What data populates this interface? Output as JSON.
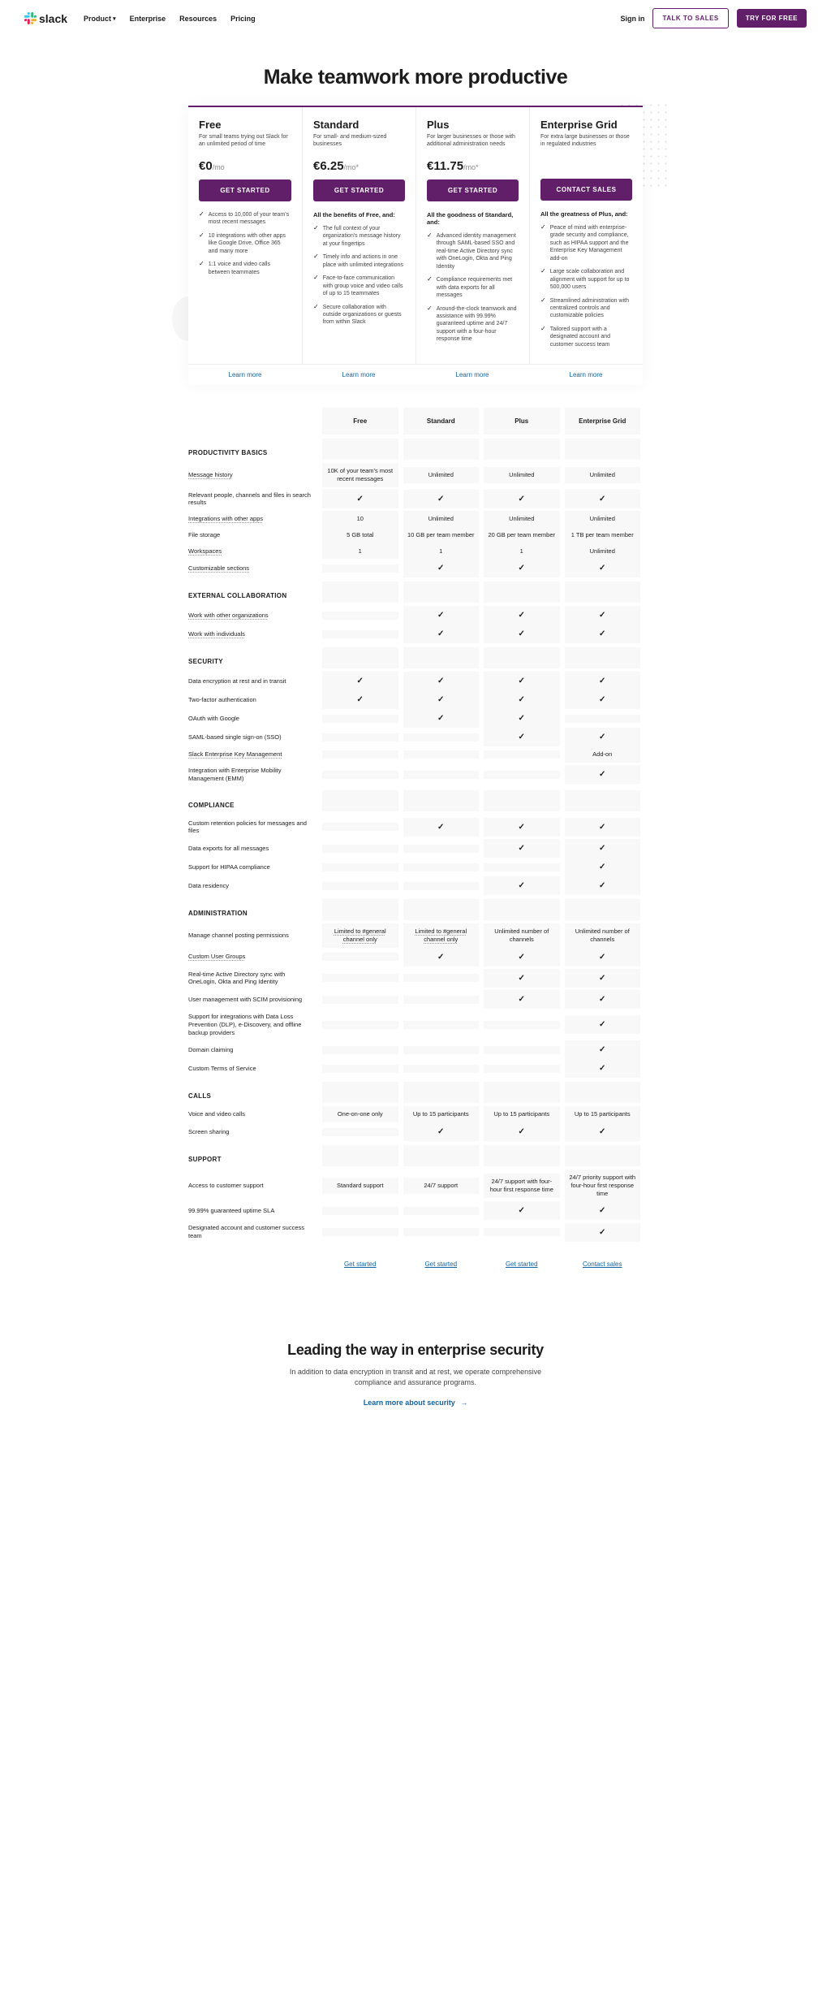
{
  "nav": {
    "brand": "slack",
    "links": [
      "Product",
      "Enterprise",
      "Resources",
      "Pricing"
    ],
    "signin": "Sign in",
    "talk": "TALK TO SALES",
    "try": "TRY FOR FREE"
  },
  "hero": {
    "title": "Make teamwork more productive"
  },
  "plans": [
    {
      "name": "Free",
      "desc": "For small teams trying out Slack for an unlimited period of time",
      "price": "€0",
      "per": "/mo",
      "cta": "GET STARTED",
      "sub": "",
      "features": [
        "Access to 10,000 of your team's most recent messages",
        "10 integrations with other apps like Google Drive, Office 365 and many more",
        "1:1 voice and video calls between teammates"
      ],
      "learn": "Learn more"
    },
    {
      "name": "Standard",
      "desc": "For small- and medium-sized businesses",
      "price": "€6.25",
      "per": "/mo*",
      "cta": "GET STARTED",
      "sub": "All the benefits of Free, and:",
      "features": [
        "The full context of your organization's message history at your fingertips",
        "Timely info and actions in one place with unlimited integrations",
        "Face-to-face communication with group voice and video calls of up to 15 teammates",
        "Secure collaboration with outside organizations or guests from within Slack"
      ],
      "learn": "Learn more"
    },
    {
      "name": "Plus",
      "desc": "For larger businesses or those with additional administration needs",
      "price": "€11.75",
      "per": "/mo*",
      "cta": "GET STARTED",
      "sub": "All the goodness of Standard, and:",
      "features": [
        "Advanced identity management through SAML-based SSO and real-time Active Directory sync with OneLogin, Okta and Ping Identity",
        "Compliance requirements met with data exports for all messages",
        "Around-the-clock teamwork and assistance with 99.99% guaranteed uptime and 24/7 support with a four-hour response time"
      ],
      "learn": "Learn more"
    },
    {
      "name": "Enterprise Grid",
      "desc": "For extra large businesses or those in regulated industries",
      "price": "",
      "per": "",
      "cta": "CONTACT SALES",
      "sub": "All the greatness of Plus, and:",
      "features": [
        "Peace of mind with enterprise-grade security and compliance, such as HIPAA support and the Enterprise Key Management add-on",
        "Large scale collaboration and alignment with support for up to 500,000 users",
        "Streamlined administration with centralized controls and customizable policies",
        "Tailored support with a designated account and customer success team"
      ],
      "learn": "Learn more"
    }
  ],
  "compare": {
    "cols": [
      "Free",
      "Standard",
      "Plus",
      "Enterprise Grid"
    ],
    "cats": [
      {
        "name": "PRODUCTIVITY BASICS",
        "rows": [
          {
            "label": "Message history",
            "ud": true,
            "cells": [
              "10K of your team's most recent messages",
              "Unlimited",
              "Unlimited",
              "Unlimited"
            ]
          },
          {
            "label": "Relevant people, channels and files in search results",
            "cells": [
              "chk",
              "chk",
              "chk",
              "chk"
            ]
          },
          {
            "label": "Integrations with other apps",
            "ud": true,
            "cells": [
              "10",
              "Unlimited",
              "Unlimited",
              "Unlimited"
            ]
          },
          {
            "label": "File storage",
            "cells": [
              "5 GB total",
              "10 GB per team member",
              "20 GB per team member",
              "1 TB per team member"
            ]
          },
          {
            "label": "Workspaces",
            "ud": true,
            "cells": [
              "1",
              "1",
              "1",
              "Unlimited"
            ]
          },
          {
            "label": "Customizable sections",
            "ud": true,
            "cells": [
              "",
              "chk",
              "chk",
              "chk"
            ]
          }
        ]
      },
      {
        "name": "EXTERNAL COLLABORATION",
        "rows": [
          {
            "label": "Work with other organizations",
            "ud": true,
            "cells": [
              "",
              "chk",
              "chk",
              "chk"
            ]
          },
          {
            "label": "Work with individuals",
            "ud": true,
            "cells": [
              "",
              "chk",
              "chk",
              "chk"
            ]
          }
        ]
      },
      {
        "name": "SECURITY",
        "rows": [
          {
            "label": "Data encryption at rest and in transit",
            "cells": [
              "chk",
              "chk",
              "chk",
              "chk"
            ]
          },
          {
            "label": "Two-factor authentication",
            "cells": [
              "chk",
              "chk",
              "chk",
              "chk"
            ]
          },
          {
            "label": "OAuth with Google",
            "cells": [
              "",
              "chk",
              "chk",
              ""
            ]
          },
          {
            "label": "SAML-based single sign-on (SSO)",
            "cells": [
              "",
              "",
              "chk",
              "chk"
            ]
          },
          {
            "label": "Slack Enterprise Key Management",
            "ud": true,
            "cells": [
              "",
              "",
              "",
              "Add-on"
            ]
          },
          {
            "label": "Integration with Enterprise Mobility Management (EMM)",
            "cells": [
              "",
              "",
              "",
              "chk"
            ]
          }
        ]
      },
      {
        "name": "COMPLIANCE",
        "rows": [
          {
            "label": "Custom retention policies for messages and files",
            "cells": [
              "",
              "chk",
              "chk",
              "chk"
            ]
          },
          {
            "label": "Data exports for all messages",
            "cells": [
              "",
              "",
              "chk",
              "chk"
            ]
          },
          {
            "label": "Support for HIPAA compliance",
            "cells": [
              "",
              "",
              "",
              "chk"
            ]
          },
          {
            "label": "Data residency",
            "cells": [
              "",
              "",
              "chk",
              "chk"
            ]
          }
        ]
      },
      {
        "name": "ADMINISTRATION",
        "rows": [
          {
            "label": "Manage channel posting permissions",
            "cells": [
              "Limited to #general channel only",
              "Limited to #general channel only",
              "Unlimited number of channels",
              "Unlimited number of channels"
            ],
            "subud": [
              true,
              true,
              false,
              false
            ]
          },
          {
            "label": "Custom User Groups",
            "ud": true,
            "cells": [
              "",
              "chk",
              "chk",
              "chk"
            ]
          },
          {
            "label": "Real-time Active Directory sync with OneLogin, Okta and Ping Identity",
            "cells": [
              "",
              "",
              "chk",
              "chk"
            ]
          },
          {
            "label": "User management with SCIM provisioning",
            "cells": [
              "",
              "",
              "chk",
              "chk"
            ]
          },
          {
            "label": "Support for integrations with Data Loss Prevention (DLP), e-Discovery, and offline backup providers",
            "cells": [
              "",
              "",
              "",
              "chk"
            ]
          },
          {
            "label": "Domain claiming",
            "cells": [
              "",
              "",
              "",
              "chk"
            ]
          },
          {
            "label": "Custom Terms of Service",
            "cells": [
              "",
              "",
              "",
              "chk"
            ]
          }
        ]
      },
      {
        "name": "CALLS",
        "rows": [
          {
            "label": "Voice and video calls",
            "cells": [
              "One-on-one only",
              "Up to 15 participants",
              "Up to 15 participants",
              "Up to 15 participants"
            ]
          },
          {
            "label": "Screen sharing",
            "cells": [
              "",
              "chk",
              "chk",
              "chk"
            ]
          }
        ]
      },
      {
        "name": "SUPPORT",
        "rows": [
          {
            "label": "Access to customer support",
            "cells": [
              "Standard support",
              "24/7 support",
              "24/7 support with four-hour first response time",
              "24/7 priority support with four-hour first response time"
            ]
          },
          {
            "label": "99.99% guaranteed uptime SLA",
            "cells": [
              "",
              "",
              "chk",
              "chk"
            ]
          },
          {
            "label": "Designated account and customer success team",
            "cells": [
              "",
              "",
              "",
              "chk"
            ]
          }
        ]
      }
    ],
    "ctas": [
      "Get started",
      "Get started",
      "Get started",
      "Contact sales"
    ]
  },
  "security": {
    "title": "Leading the way in enterprise security",
    "body": "In addition to data encryption in transit and at rest, we operate comprehensive compliance and assurance programs.",
    "link": "Learn more about security"
  }
}
